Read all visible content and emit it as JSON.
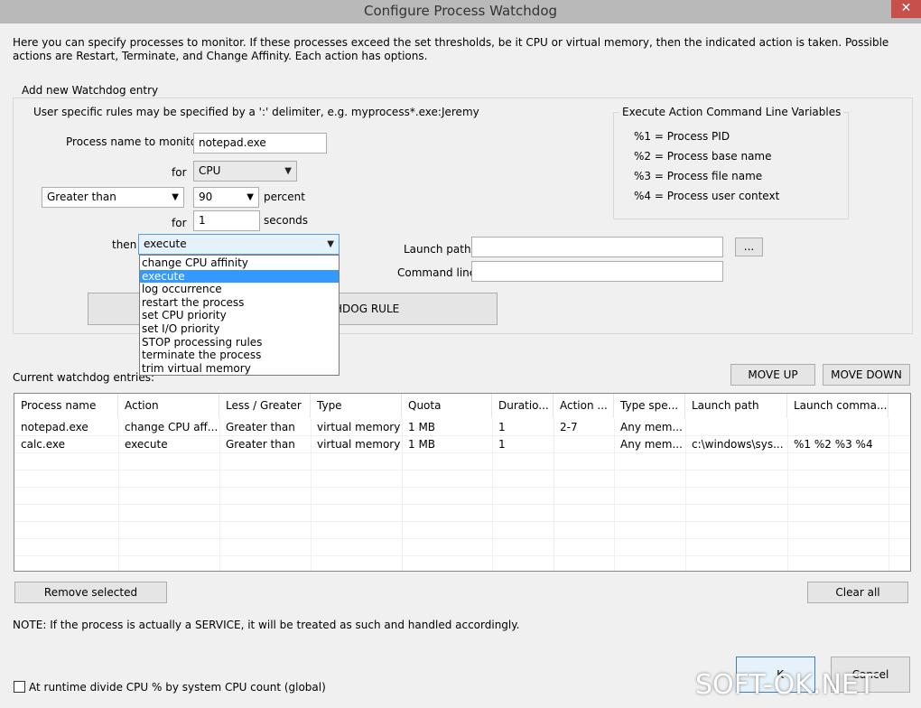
{
  "window": {
    "title": "Configure Process Watchdog",
    "close_glyph": "✕"
  },
  "intro_text": "Here you can specify processes to monitor. If these processes exceed the set thresholds, be it CPU or virtual memory, then the indicated action is taken. Possible actions are Restart, Terminate, and Change Affinity. Each action has options.",
  "new_entry": {
    "group_title": "Add new Watchdog entry",
    "hint": "User specific rules may be specified by a ':' delimiter, e.g. myprocess*.exe:Jeremy",
    "process_label": "Process name to monitor",
    "process_value": "notepad.exe",
    "for_label": "for",
    "resource_value": "CPU",
    "comparison_value": "Greater than",
    "threshold_value": "90",
    "percent_label": "percent",
    "for2_label": "for",
    "duration_value": "1",
    "seconds_label": "seconds",
    "then_label": "then",
    "action_value": "execute",
    "launch_path_label": "Launch path:",
    "launch_path_value": "",
    "browse_label": "...",
    "command_line_label": "Command line:",
    "command_line_value": "",
    "add_rule_label": "ADD WATCHDOG RULE",
    "add_rule_visible_text": "HDOG RULE"
  },
  "action_dropdown": {
    "options": [
      "change CPU affinity",
      "execute",
      "log occurrence",
      "restart the process",
      "set CPU priority",
      "set I/O priority",
      "STOP processing rules",
      "terminate the process",
      "trim virtual memory"
    ],
    "selected": "execute"
  },
  "variables": {
    "group_title": "Execute Action Command Line Variables",
    "items": [
      "%1 = Process PID",
      "%2 = Process base name",
      "%3 = Process file name",
      "%4 = Process user context"
    ]
  },
  "entries": {
    "label": "Current watchdog entries:",
    "move_up_label": "MOVE UP",
    "move_down_label": "MOVE DOWN",
    "columns": [
      "Process name",
      "Action",
      "Less / Greater",
      "Type",
      "Quota",
      "Duratio...",
      "Action ...",
      "Type spe...",
      "Launch path",
      "Launch comma..."
    ],
    "rows": [
      [
        "notepad.exe",
        "change CPU aff...",
        "Greater than",
        "virtual memory",
        "1 MB",
        "1",
        "2-7",
        "Any mem...",
        "",
        ""
      ],
      [
        "calc.exe",
        "execute",
        "Greater than",
        "virtual memory",
        "1 MB",
        "1",
        "",
        "Any mem...",
        "c:\\windows\\sys...",
        "%1 %2 %3 %4"
      ]
    ],
    "remove_label": "Remove selected",
    "clear_label": "Clear all"
  },
  "note": "NOTE: If the process is actually a SERVICE, it will be treated as such and handled accordingly.",
  "global_option": {
    "label": "At runtime divide CPU % by system CPU count (global)",
    "checked": false
  },
  "footer": {
    "ok_label": "OK",
    "cancel_label": "Cancel",
    "ok_visible": "K",
    "cancel_visible": "Cancel"
  },
  "watermark": "SOFT-OK.NET"
}
